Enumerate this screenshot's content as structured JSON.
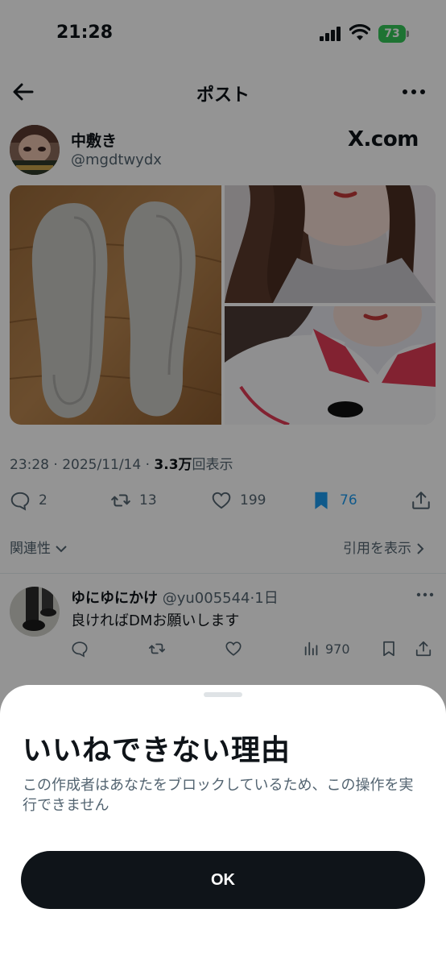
{
  "status_bar": {
    "time": "21:28",
    "battery": "73"
  },
  "header": {
    "title": "ポスト"
  },
  "author": {
    "name": "中敷き",
    "handle": "@mgdtwydx",
    "badge": "X.com"
  },
  "post": {
    "meta_time": "23:28 · 2025/11/14 · ",
    "views_count": "3.3万",
    "views_label": "回表示"
  },
  "actions": {
    "replies": "2",
    "reposts": "13",
    "likes": "199",
    "bookmarks": "76"
  },
  "sort": {
    "label": "関連性"
  },
  "quotes_link": {
    "label": "引用を表示"
  },
  "reply": {
    "name": "ゆにゆにかけ",
    "handle": "@yu005544",
    "time": "·1日",
    "text": "良ければDMお願いします",
    "views": "970"
  },
  "sheet": {
    "title": "いいねできない理由",
    "body": "この作成者はあなたをブロックしているため、この操作を実行できません",
    "ok_label": "OK"
  },
  "colors": {
    "bookmark_active": "#1d9bf0",
    "battery": "#34c759",
    "button": "#0f1419"
  }
}
